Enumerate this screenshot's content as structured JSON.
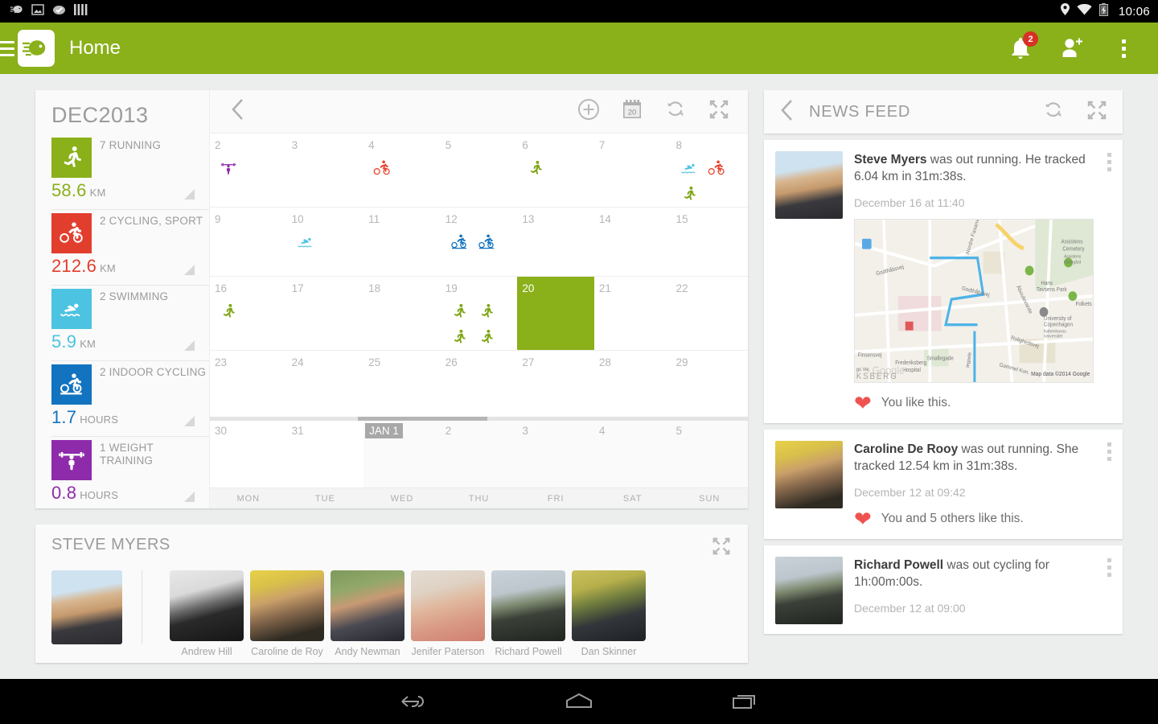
{
  "statusbar": {
    "time": "10:06",
    "icons": [
      "app-notification-icon",
      "image-icon",
      "checkmark-cloud-icon",
      "bars-icon"
    ],
    "right_icons": [
      "location-icon",
      "wifi-icon",
      "battery-charging-icon"
    ]
  },
  "appbar": {
    "title": "Home",
    "menu_icon": "hamburger-menu-icon",
    "logo_icon": "endomondo-logo-icon",
    "notifications_badge": "2",
    "actions": [
      "bell-icon",
      "add-friend-icon",
      "overflow-menu-icon"
    ],
    "brand_color": "#8ab01a"
  },
  "calendar": {
    "month_title": "DEC2013",
    "back_icon": "chevron-left-icon",
    "tools": [
      "add-circle-icon",
      "calendar-today-icon",
      "refresh-icon",
      "expand-icon"
    ],
    "today_date_badge": "20",
    "stats": [
      {
        "count_label": "7 RUNNING",
        "value": "58.6",
        "unit": "KM",
        "color": "#8ab01a",
        "icon": "running-icon"
      },
      {
        "count_label": "2 CYCLING, SPORT",
        "value": "212.6",
        "unit": "KM",
        "color": "#e23e2e",
        "icon": "cycling-sport-icon"
      },
      {
        "count_label": "2 SWIMMING",
        "value": "5.9",
        "unit": "KM",
        "color": "#4cc3e0",
        "icon": "swimming-icon"
      },
      {
        "count_label": "2 INDOOR CYCLING",
        "value": "1.7",
        "unit": "HOURS",
        "color": "#1273c0",
        "icon": "indoor-cycling-icon"
      },
      {
        "count_label": "1 WEIGHT TRAINING",
        "value": "0.8",
        "unit": "HOURS",
        "color": "#8e2bab",
        "icon": "weight-training-icon"
      }
    ],
    "weekdays": [
      "MON",
      "TUE",
      "WED",
      "THU",
      "FRI",
      "SAT",
      "SUN"
    ],
    "weeks": [
      [
        {
          "day": "2",
          "acts": [
            "weights"
          ]
        },
        {
          "day": "3",
          "acts": []
        },
        {
          "day": "4",
          "acts": [
            "bike-red"
          ]
        },
        {
          "day": "5",
          "acts": []
        },
        {
          "day": "6",
          "acts": [
            "run"
          ]
        },
        {
          "day": "7",
          "acts": []
        },
        {
          "day": "8",
          "acts": [
            "swim",
            "bike-red",
            "run"
          ]
        }
      ],
      [
        {
          "day": "9",
          "acts": []
        },
        {
          "day": "10",
          "acts": [
            "swim"
          ]
        },
        {
          "day": "11",
          "acts": []
        },
        {
          "day": "12",
          "acts": [
            "bike-blue",
            "bike-blue"
          ]
        },
        {
          "day": "13",
          "acts": []
        },
        {
          "day": "14",
          "acts": []
        },
        {
          "day": "15",
          "acts": []
        }
      ],
      [
        {
          "day": "16",
          "acts": [
            "run"
          ]
        },
        {
          "day": "17",
          "acts": []
        },
        {
          "day": "18",
          "acts": []
        },
        {
          "day": "19",
          "acts": [
            "run",
            "run",
            "run",
            "run"
          ]
        },
        {
          "day": "20",
          "acts": [],
          "today": true
        },
        {
          "day": "21",
          "acts": []
        },
        {
          "day": "22",
          "acts": []
        }
      ],
      [
        {
          "day": "23",
          "acts": []
        },
        {
          "day": "24",
          "acts": []
        },
        {
          "day": "25",
          "acts": []
        },
        {
          "day": "26",
          "acts": []
        },
        {
          "day": "27",
          "acts": []
        },
        {
          "day": "28",
          "acts": []
        },
        {
          "day": "29",
          "acts": []
        }
      ],
      [
        {
          "day": "30",
          "acts": []
        },
        {
          "day": "31",
          "acts": []
        },
        {
          "day": "JAN 1",
          "acts": [],
          "badge": true,
          "other": true
        },
        {
          "day": "2",
          "acts": [],
          "other": true
        },
        {
          "day": "3",
          "acts": [],
          "other": true
        },
        {
          "day": "4",
          "acts": [],
          "other": true
        },
        {
          "day": "5",
          "acts": [],
          "other": true
        }
      ]
    ]
  },
  "friends_panel": {
    "title": "STEVE MYERS",
    "expand_icon": "expand-icon",
    "me_photo": "steve-myers-photo",
    "friends": [
      {
        "name": "Andrew Hill",
        "photo": "andrew-hill-photo"
      },
      {
        "name": "Caroline de Roy",
        "photo": "caroline-de-roy-photo"
      },
      {
        "name": "Andy Newman",
        "photo": "andy-newman-photo"
      },
      {
        "name": "Jenifer Paterson",
        "photo": "jenifer-paterson-photo"
      },
      {
        "name": "Richard Powell",
        "photo": "richard-powell-photo"
      },
      {
        "name": "Dan Skinner",
        "photo": "dan-skinner-photo"
      }
    ]
  },
  "newsfeed": {
    "title": "NEWS FEED",
    "back_icon": "chevron-left-icon",
    "tools": [
      "refresh-icon",
      "expand-icon"
    ],
    "items": [
      {
        "author": "Steve Myers",
        "text": " was out running. He tracked 6.04 km in 31m:38s.",
        "time": "December 16 at 11:40",
        "photo": "steve-myers-photo",
        "has_map": true,
        "map_attribution": "Map data ©2014 Google",
        "map_labels": [
          "Assistens Cemetery",
          "Assistens Kirkegård",
          "Hans Tavsens Park",
          "Folkets",
          "Godthåbsvej",
          "Nordre Fasanvej",
          "Åboulevarde",
          "Rolighedsvej",
          "Frederiksberg Hospital",
          "University of Copenhagen",
          "Københavns Universitet",
          "Smallegade",
          "Gammel Kongevej",
          "Finsensvej",
          "Nordre Fasanvej",
          "gs Vej",
          "Google",
          "KSBERG"
        ],
        "like_text": "You like this."
      },
      {
        "author": "Caroline De Rooy",
        "text": " was out running. She tracked 12.54 km in 31m:38s.",
        "time": "December 12 at 09:42",
        "photo": "caroline-de-roy-photo",
        "has_map": false,
        "like_text": "You and 5 others like this."
      },
      {
        "author": "Richard Powell",
        "text": " was out cycling for 1h:00m:00s.",
        "time": "December 12 at 09:00",
        "photo": "richard-powell-photo",
        "has_map": false,
        "like_text": ""
      }
    ]
  },
  "navbar": {
    "buttons": [
      "back-icon",
      "home-icon",
      "recents-icon"
    ]
  }
}
